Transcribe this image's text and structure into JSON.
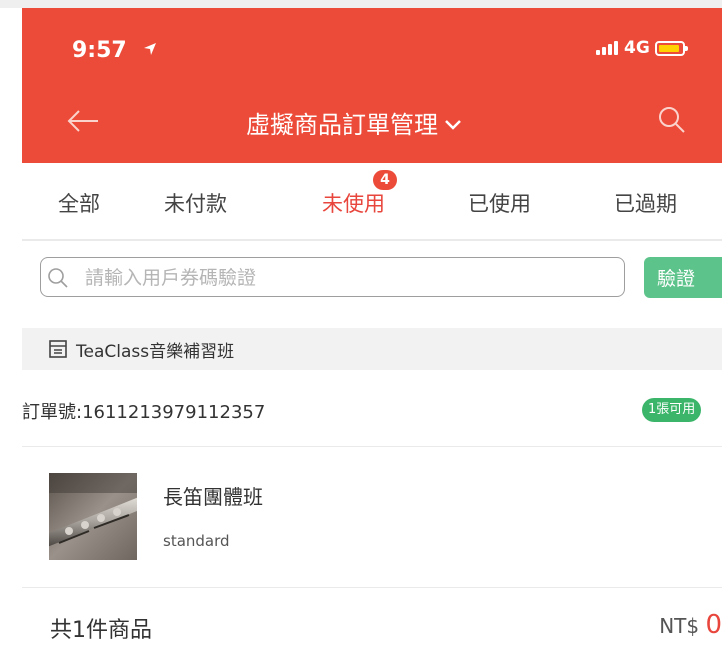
{
  "status_bar": {
    "time": "9:57",
    "network": "4G"
  },
  "header": {
    "title": "虛擬商品訂單管理"
  },
  "tabs": [
    {
      "label": "全部"
    },
    {
      "label": "未付款"
    },
    {
      "label": "未使用",
      "badge": "4"
    },
    {
      "label": "已使用"
    },
    {
      "label": "已過期"
    }
  ],
  "verify": {
    "placeholder": "請輸入用戶券碼驗證",
    "button_label": "驗證"
  },
  "shop": {
    "name": "TeaClass音樂補習班"
  },
  "order": {
    "number_text": "訂單號:1611213979112357",
    "status_badge": "1張可用",
    "item": {
      "name": "長笛團體班",
      "variant": "standard",
      "thumbnail": "flute-photo"
    },
    "total_count_text": "共1件商品",
    "currency": "NT$",
    "amount": "0"
  },
  "colors": {
    "brand": "#ec4b39",
    "active_tab": "#e8453c",
    "verify_button": "#5cc38a",
    "available_badge": "#3bb56a"
  }
}
